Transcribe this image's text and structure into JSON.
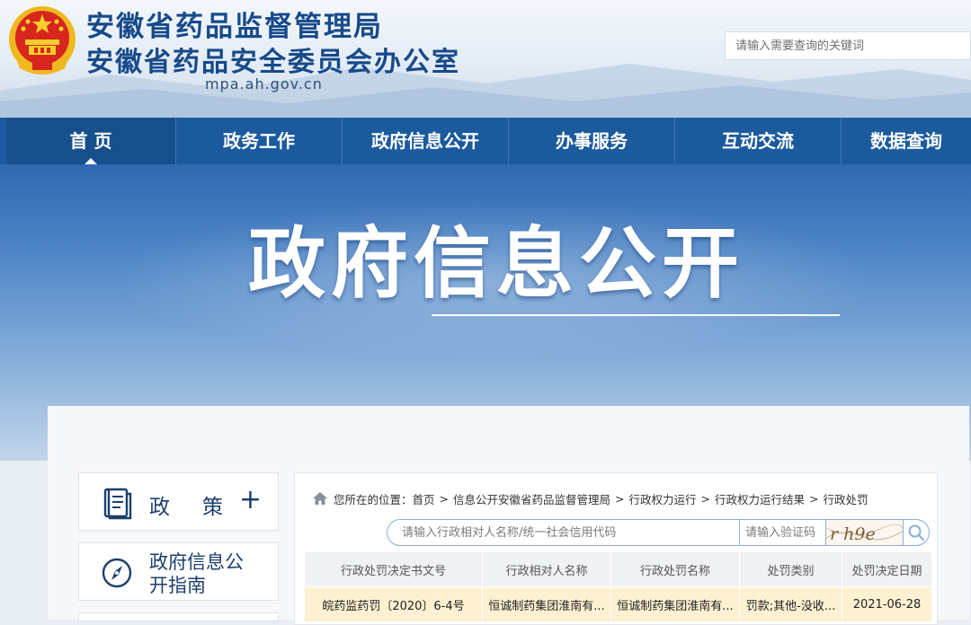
{
  "header": {
    "title_line1": "安徽省药品监督管理局",
    "title_line2": "安徽省药品安全委员会办公室",
    "domain": "mpa.ah.gov.cn",
    "search_placeholder": "请输入需要查询的关键词"
  },
  "nav": {
    "items": [
      {
        "label": "首 页",
        "active": true
      },
      {
        "label": "政务工作"
      },
      {
        "label": "政府信息公开"
      },
      {
        "label": "办事服务"
      },
      {
        "label": "互动交流"
      },
      {
        "label": "数据查询"
      }
    ]
  },
  "banner": {
    "title": "政府信息公开"
  },
  "sidebar": {
    "items": [
      {
        "label": "政策",
        "plus": "+",
        "icon": "book-icon"
      },
      {
        "label": "政府信息公开指南",
        "icon": "compass-icon"
      }
    ]
  },
  "breadcrumb": {
    "prefix": "您所在的位置：",
    "items": [
      "首页",
      "信息公开安徽省药品监督管理局",
      "行政权力运行",
      "行政权力运行结果",
      "行政处罚"
    ],
    "separator": ">"
  },
  "query": {
    "name_placeholder": "请输入行政相对人名称/统一社会信用代码",
    "code_placeholder": "请输入验证码",
    "captcha_text": "r h9e"
  },
  "table": {
    "headers": [
      "行政处罚决定书文号",
      "行政相对人名称",
      "行政处罚名称",
      "处罚类别",
      "处罚决定日期"
    ],
    "rows": [
      [
        "皖药监药罚〔2020〕6-4号",
        "恒诚制药集团淮南有...",
        "恒诚制药集团淮南有...",
        "罚款;其他-没收...",
        "2021-06-28"
      ]
    ]
  },
  "colors": {
    "nav_bg": "#1b5a9d",
    "title_blue": "#174a8a",
    "row_highlight": "#fdf1d2"
  }
}
